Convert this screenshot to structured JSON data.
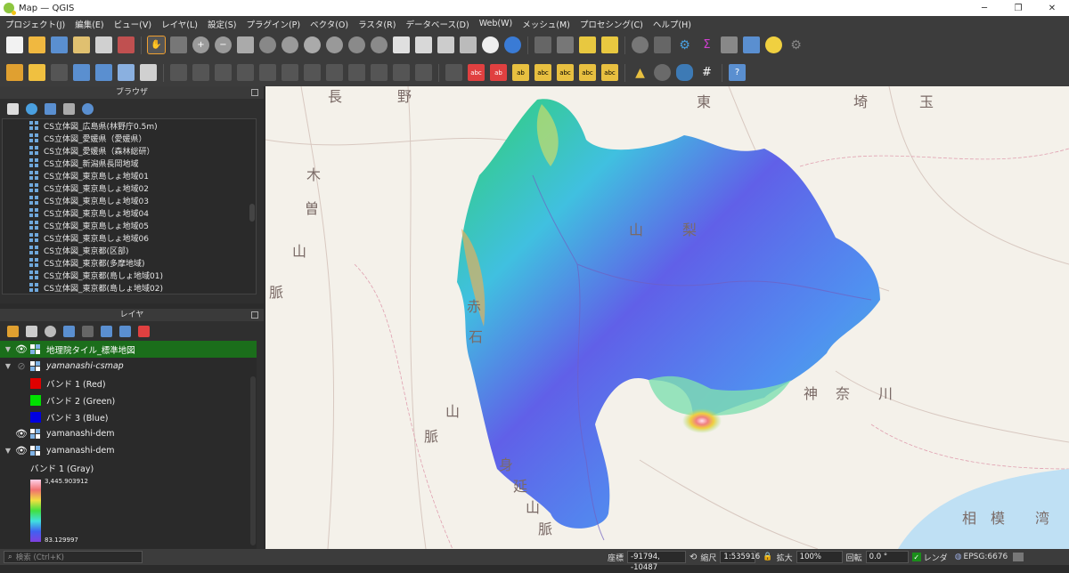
{
  "window": {
    "title": "Map — QGIS",
    "minimize": "─",
    "maximize": "❐",
    "close": "✕"
  },
  "menu": [
    "プロジェクト(J)",
    "編集(E)",
    "ビュー(V)",
    "レイヤ(L)",
    "設定(S)",
    "プラグイン(P)",
    "ベクタ(O)",
    "ラスタ(R)",
    "データベース(D)",
    "Web(W)",
    "メッシュ(M)",
    "プロセシング(C)",
    "ヘルプ(H)"
  ],
  "browser": {
    "title": "ブラウザ",
    "items": [
      "CS立体図_広島県(林野庁0.5m)",
      "CS立体図_愛媛県（愛媛県）",
      "CS立体図_愛媛県（森林総研）",
      "CS立体図_新潟県長岡地域",
      "CS立体図_東京島しょ地域01",
      "CS立体図_東京島しょ地域02",
      "CS立体図_東京島しょ地域03",
      "CS立体図_東京島しょ地域04",
      "CS立体図_東京島しょ地域05",
      "CS立体図_東京島しょ地域06",
      "CS立体図_東京都(区部)",
      "CS立体図_東京都(多摩地域)",
      "CS立体図_東京都(島しょ地域01)",
      "CS立体図_東京都(島しょ地域02)"
    ]
  },
  "layers": {
    "title": "レイヤ",
    "items": [
      {
        "name": "地理院タイル_標準地図",
        "active": true,
        "visible": true,
        "expandable": true
      },
      {
        "name": "yamanashi-csmap",
        "active": false,
        "visible": false,
        "expandable": true
      },
      {
        "name": "yamanashi-dem",
        "active": false,
        "visible": true,
        "expandable": false
      },
      {
        "name": "yamanashi-dem",
        "active": false,
        "visible": true,
        "expandable": true
      }
    ],
    "bands": [
      {
        "label": "バンド 1 (Red)",
        "color": "#e00000"
      },
      {
        "label": "バンド 2 (Green)",
        "color": "#00e000"
      },
      {
        "label": "バンド 3 (Blue)",
        "color": "#0000e0"
      }
    ],
    "gray_band": "バンド 1 (Gray)",
    "ramp_max": "3,445.903912",
    "ramp_min": "83.129997"
  },
  "map_labels": [
    "長",
    "野",
    "東",
    "埼",
    "玉",
    "山",
    "梨",
    "木",
    "曽",
    "山",
    "脈",
    "赤",
    "石",
    "山",
    "脈",
    "神",
    "奈",
    "川",
    "相",
    "模",
    "湾",
    "身",
    "延",
    "山",
    "脈"
  ],
  "status": {
    "search_placeholder": "検索 (Ctrl+K)",
    "coord_label": "座標",
    "coord_value": "-91794, -10487",
    "scale_label": "縮尺",
    "scale_value": "1:535916",
    "magnifier_label": "拡大",
    "magnifier_value": "100%",
    "rotation_label": "回転",
    "rotation_value": "0.0 °",
    "render_label": "レンダ",
    "crs": "EPSG:6676"
  },
  "colors": {
    "active_layer": "#1b6e1b",
    "accent": "#f0a030"
  }
}
